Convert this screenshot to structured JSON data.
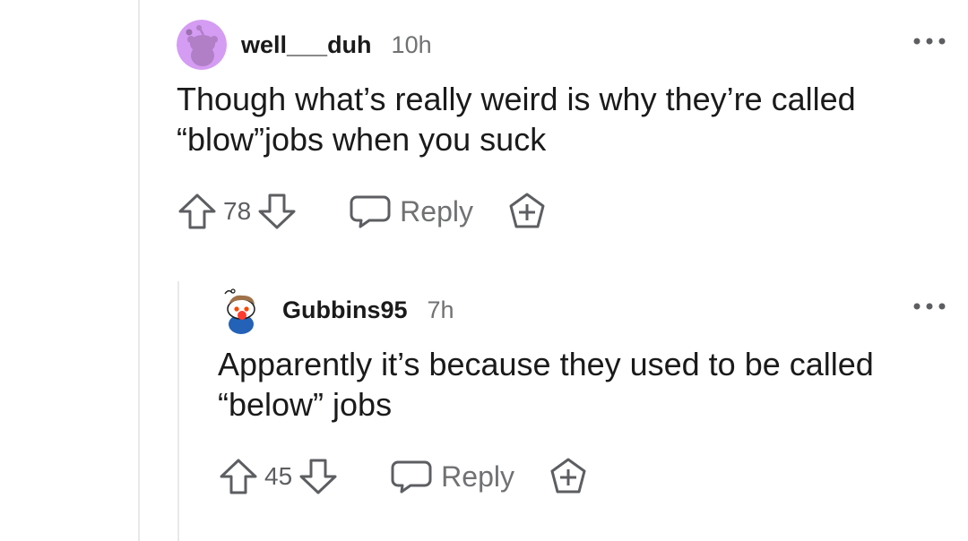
{
  "comments": [
    {
      "username": "well___duh",
      "age": "10h",
      "body_line1": "Though what’s really weird is why they’re called",
      "body_line2": "“blow”jobs when you suck",
      "score": "78",
      "reply_label": "Reply",
      "avatar_color": "#d59cf3"
    },
    {
      "username": "Gubbins95",
      "age": "7h",
      "body_line1": "Apparently it’s because they used to be called",
      "body_line2": "“below” jobs",
      "score": "45",
      "reply_label": "Reply",
      "avatar_color": "#2462b8"
    }
  ],
  "icons": {
    "upvote": "upvote-icon",
    "downvote": "downvote-icon",
    "reply": "reply-icon",
    "award": "award-icon",
    "more": "more-icon"
  },
  "colors": {
    "text": "#1a1a1b",
    "muted": "#6f7173",
    "icon": "#5c5e61",
    "thread_line": "#e9e9ea"
  }
}
